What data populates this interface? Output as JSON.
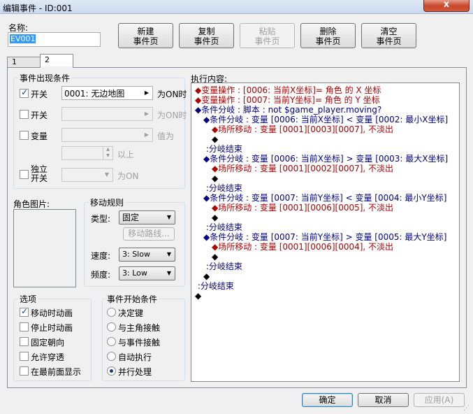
{
  "window": {
    "title": "编辑事件 - ID:001",
    "close_glyph": "x"
  },
  "name": {
    "label": "名称:",
    "value": "EV001"
  },
  "toolbar": [
    {
      "id": "new",
      "line1": "新建",
      "line2": "事件页",
      "enabled": true
    },
    {
      "id": "copy",
      "line1": "复制",
      "line2": "事件页",
      "enabled": true
    },
    {
      "id": "paste",
      "line1": "粘贴",
      "line2": "事件页",
      "enabled": false
    },
    {
      "id": "delete",
      "line1": "删除",
      "line2": "事件页",
      "enabled": true
    },
    {
      "id": "clear",
      "line1": "清空",
      "line2": "事件页",
      "enabled": true
    }
  ],
  "tabs": [
    {
      "label": "1",
      "active": false
    },
    {
      "label": "2",
      "active": true
    }
  ],
  "conditions": {
    "title": "事件出现条件",
    "switch1": {
      "label": "开关",
      "checked": true,
      "value": "0001: 无边地图",
      "suffix": "为ON时"
    },
    "switch2": {
      "label": "开关",
      "checked": false,
      "value": "",
      "suffix": "为ON时"
    },
    "variable": {
      "label": "变量",
      "checked": false,
      "value": "",
      "suffix": "值为",
      "min_suffix": "以上"
    },
    "self_switch": {
      "label_line1": "独立",
      "label_line2": "开关",
      "checked": false,
      "suffix": "为ON"
    }
  },
  "graphic": {
    "label": "角色图片:"
  },
  "movement": {
    "title": "移动规则",
    "type_label": "类型:",
    "type_value": "固定",
    "route_button": "移动路线...",
    "speed_label": "速度:",
    "speed_value": "3: Slow",
    "freq_label": "频度:",
    "freq_value": "3: Low"
  },
  "options": {
    "title": "选项",
    "items": [
      {
        "label": "移动时动画",
        "checked": true
      },
      {
        "label": "停止时动画",
        "checked": false
      },
      {
        "label": "固定朝向",
        "checked": false
      },
      {
        "label": "允许穿透",
        "checked": false
      },
      {
        "label": "在最前面显示",
        "checked": false
      }
    ]
  },
  "trigger": {
    "title": "事件开始条件",
    "items": [
      {
        "label": "决定键",
        "checked": false
      },
      {
        "label": "与主角接触",
        "checked": false
      },
      {
        "label": "与事件接触",
        "checked": false
      },
      {
        "label": "自动执行",
        "checked": false
      },
      {
        "label": "并行处理",
        "checked": true
      }
    ]
  },
  "contents": {
    "label": "执行内容:",
    "lines": [
      {
        "indent": 0,
        "color": "red",
        "text": "◆变量操作 : [0006: 当前X坐标]= 角色 的 X 坐标"
      },
      {
        "indent": 0,
        "color": "red",
        "text": "◆变量操作 : [0007: 当前Y坐标]= 角色 的 Y 坐标"
      },
      {
        "indent": 0,
        "color": "navy",
        "text": "◆条件分岐 : 脚本 : not $game_player.moving?"
      },
      {
        "indent": 1,
        "color": "navy",
        "text": "◆条件分岐 : 变量 [0006: 当前X坐标] < 变量 [0002: 最小X坐标]"
      },
      {
        "indent": 2,
        "color": "red",
        "text": "◆场所移动 : 变量 [0001][0003][0007], 不淡出"
      },
      {
        "indent": 2,
        "color": "blk",
        "text": "◆"
      },
      {
        "indent": 1,
        "color": "navy",
        "text": " :分岐结束"
      },
      {
        "indent": 1,
        "color": "navy",
        "text": "◆条件分岐 : 变量 [0006: 当前X坐标] > 变量 [0003: 最大X坐标]"
      },
      {
        "indent": 2,
        "color": "red",
        "text": "◆场所移动 : 变量 [0001][0002][0007], 不淡出"
      },
      {
        "indent": 2,
        "color": "blk",
        "text": "◆"
      },
      {
        "indent": 1,
        "color": "navy",
        "text": " :分岐结束"
      },
      {
        "indent": 1,
        "color": "navy",
        "text": "◆条件分岐 : 变量 [0007: 当前Y坐标] < 变量 [0004: 最小Y坐标]"
      },
      {
        "indent": 2,
        "color": "red",
        "text": "◆场所移动 : 变量 [0001][0006][0005], 不淡出"
      },
      {
        "indent": 2,
        "color": "blk",
        "text": "◆"
      },
      {
        "indent": 1,
        "color": "navy",
        "text": " :分岐结束"
      },
      {
        "indent": 1,
        "color": "navy",
        "text": "◆条件分岐 : 变量 [0007: 当前Y坐标] > 变量 [0005: 最大Y坐标]"
      },
      {
        "indent": 2,
        "color": "red",
        "text": "◆场所移动 : 变量 [0001][0006][0004], 不淡出"
      },
      {
        "indent": 2,
        "color": "blk",
        "text": "◆"
      },
      {
        "indent": 1,
        "color": "navy",
        "text": " :分岐结束"
      },
      {
        "indent": 1,
        "color": "blk",
        "text": "◆"
      },
      {
        "indent": 0,
        "color": "navy",
        "text": " :分岐结束"
      },
      {
        "indent": 0,
        "color": "blk",
        "text": "◆"
      }
    ]
  },
  "footer": {
    "ok": "确定",
    "cancel": "取消",
    "apply": "应用(A)"
  }
}
